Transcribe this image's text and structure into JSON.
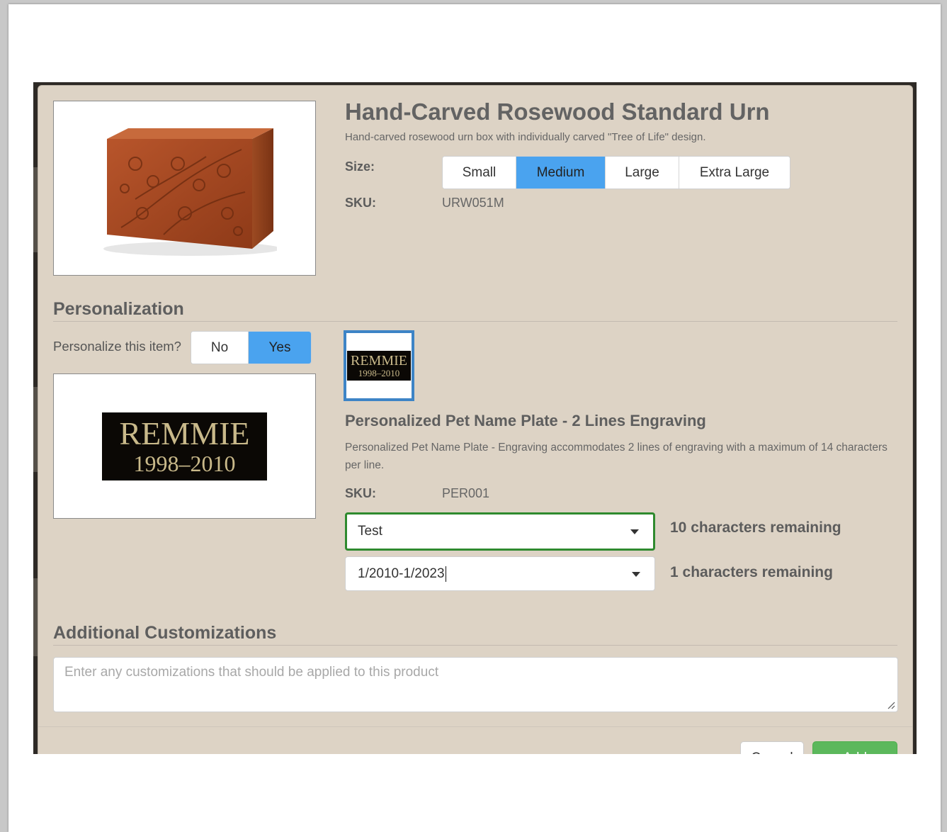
{
  "product": {
    "title": "Hand-Carved Rosewood Standard Urn",
    "description": "Hand-carved rosewood urn box with individually carved \"Tree of Life\" design.",
    "size_label": "Size:",
    "sizes": [
      "Small",
      "Medium",
      "Large",
      "Extra Large"
    ],
    "selected_size": "Medium",
    "sku_label": "SKU:",
    "sku": "URW051M",
    "image_icon": "rosewood-urn-image"
  },
  "personalization": {
    "section_title": "Personalization",
    "question": "Personalize this item?",
    "options": [
      "No",
      "Yes"
    ],
    "selected": "Yes",
    "plate_preview": {
      "line1": "REMMIE",
      "line2": "1998–2010"
    },
    "plate_title": "Personalized Pet Name Plate - 2 Lines Engraving",
    "plate_description": "Personalized Pet Name Plate - Engraving accommodates 2 lines of engraving with a maximum of 14 characters per line.",
    "sku_label": "SKU:",
    "sku": "PER001",
    "line1_value": "Test",
    "line1_remaining": "10 characters remaining",
    "line2_value": "1/2010-1/2023",
    "line2_remaining": "1 characters remaining"
  },
  "additional": {
    "section_title": "Additional Customizations",
    "placeholder": "Enter any customizations that should be applied to this product"
  },
  "footer": {
    "cancel_label": "Cancel",
    "add_label": "Add"
  },
  "colors": {
    "modal_bg": "#ddd3c5",
    "accent_blue": "#4aa3ef",
    "focus_green": "#2f8a2f",
    "add_green": "#5cb85c"
  }
}
